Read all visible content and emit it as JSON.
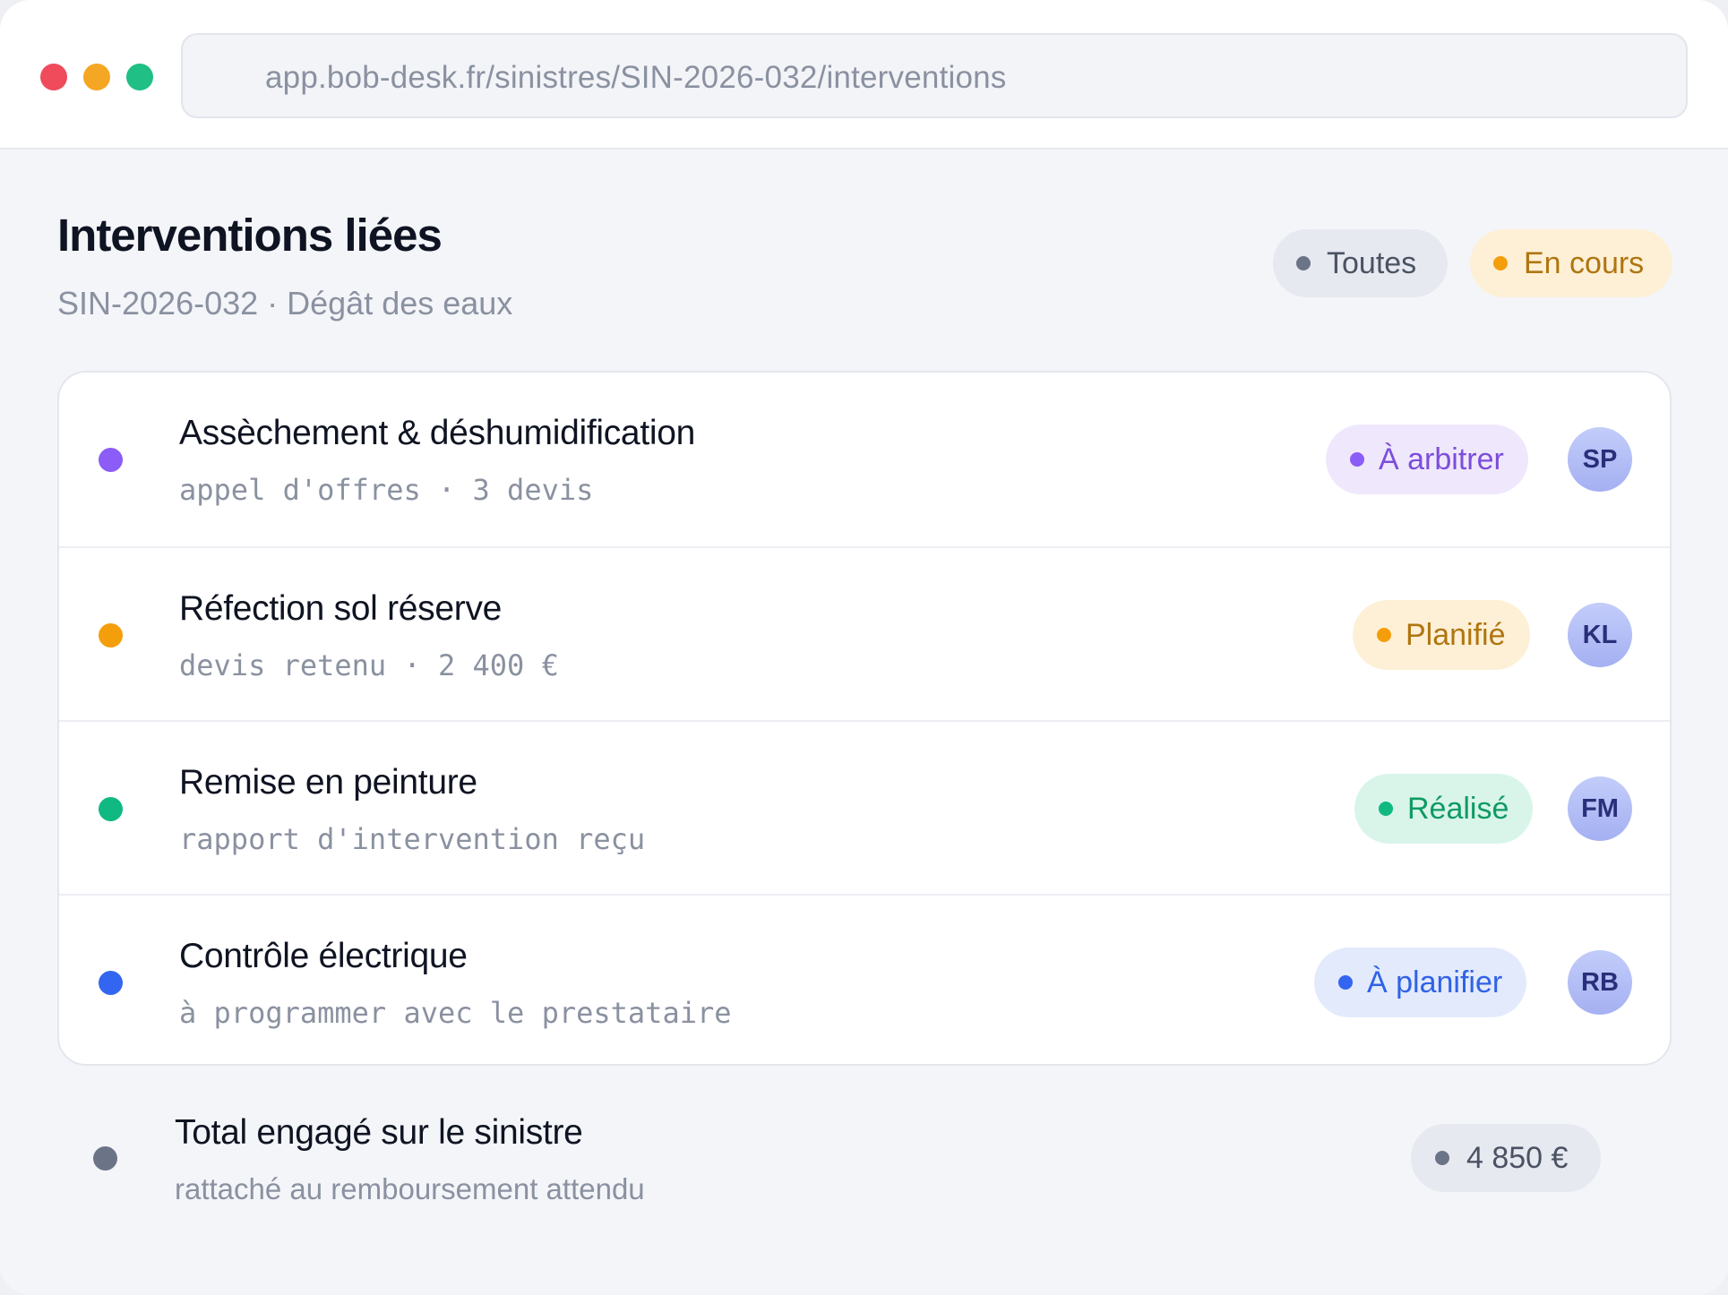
{
  "browser": {
    "url": "app.bob-desk.fr/sinistres/SIN-2026-032/interventions"
  },
  "header": {
    "title": "Interventions liées",
    "subtitle": "SIN-2026-032 · Dégât des eaux"
  },
  "filters": [
    {
      "label": "Toutes",
      "color": "#6b7487"
    },
    {
      "label": "En cours",
      "color": "#f59e0b"
    }
  ],
  "interventions": [
    {
      "title": "Assèchement & déshumidification",
      "detail": "appel d'offres · 3 devis",
      "status": "À arbitrer",
      "status_color": "#7c4ddb",
      "dot_color": "#8b5cf6",
      "assignee": "SP"
    },
    {
      "title": "Réfection sol réserve",
      "detail": "devis retenu · 2 400 €",
      "status": "Planifié",
      "status_color": "#b07510",
      "dot_color": "#f59e0b",
      "assignee": "KL"
    },
    {
      "title": "Remise en peinture",
      "detail": "rapport d'intervention reçu",
      "status": "Réalisé",
      "status_color": "#0f9a64",
      "dot_color": "#10b981",
      "assignee": "FM"
    },
    {
      "title": "Contrôle électrique",
      "detail": "à programmer avec le prestataire",
      "status": "À planifier",
      "status_color": "#2f62e6",
      "dot_color": "#3366f0",
      "assignee": "RB"
    }
  ],
  "total": {
    "title": "Total engagé sur le sinistre",
    "detail": "rattaché au remboursement attendu",
    "amount": "4 850 €"
  }
}
